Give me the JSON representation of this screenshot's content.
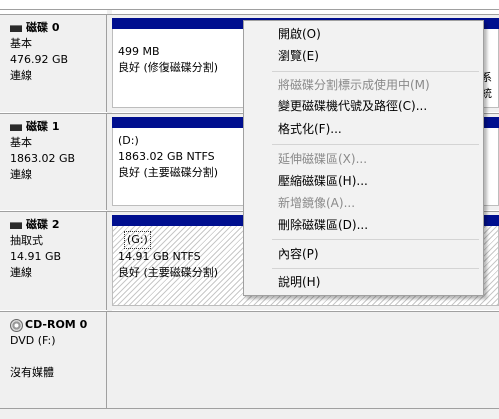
{
  "disks": [
    {
      "name": "磁碟 0",
      "type": "基本",
      "size": "476.92 GB",
      "status": "連線",
      "partition": {
        "line1": "499 MB",
        "line2": "良好 (修復磁碟分割)"
      },
      "edge_text": "系統"
    },
    {
      "name": "磁碟 1",
      "type": "基本",
      "size": "1863.02 GB",
      "status": "連線",
      "partition": {
        "label": "(D:)",
        "line1": "1863.02 GB NTFS",
        "line2": "良好 (主要磁碟分割)"
      }
    },
    {
      "name": "磁碟 2",
      "type": "抽取式",
      "size": "14.91 GB",
      "status": "連線",
      "partition": {
        "label": "(G:)",
        "line1": "14.91 GB NTFS",
        "line2": "良好 (主要磁碟分割)"
      }
    },
    {
      "name": "CD-ROM 0",
      "type": "DVD (F:)",
      "status": "沒有媒體"
    }
  ],
  "context_menu": {
    "items": [
      {
        "label": "開啟(O)",
        "enabled": true
      },
      {
        "label": "瀏覽(E)",
        "enabled": true
      },
      {
        "label": "將磁碟分割標示成使用中(M)",
        "enabled": false
      },
      {
        "label": "變更磁碟機代號及路徑(C)...",
        "enabled": true
      },
      {
        "label": "格式化(F)...",
        "enabled": true
      },
      {
        "label": "延伸磁碟區(X)...",
        "enabled": false
      },
      {
        "label": "壓縮磁碟區(H)...",
        "enabled": true
      },
      {
        "label": "新增鏡像(A)...",
        "enabled": false
      },
      {
        "label": "刪除磁碟區(D)...",
        "enabled": true
      },
      {
        "label": "內容(P)",
        "enabled": true
      },
      {
        "label": "說明(H)",
        "enabled": true
      }
    ]
  },
  "colors": {
    "partition_bar": "#000f8f",
    "panel_bg": "#f0f0f0",
    "disabled_text": "#8a8a8a"
  },
  "icons": {
    "disk": "hard-disk-icon",
    "cdrom": "cdrom-icon"
  }
}
